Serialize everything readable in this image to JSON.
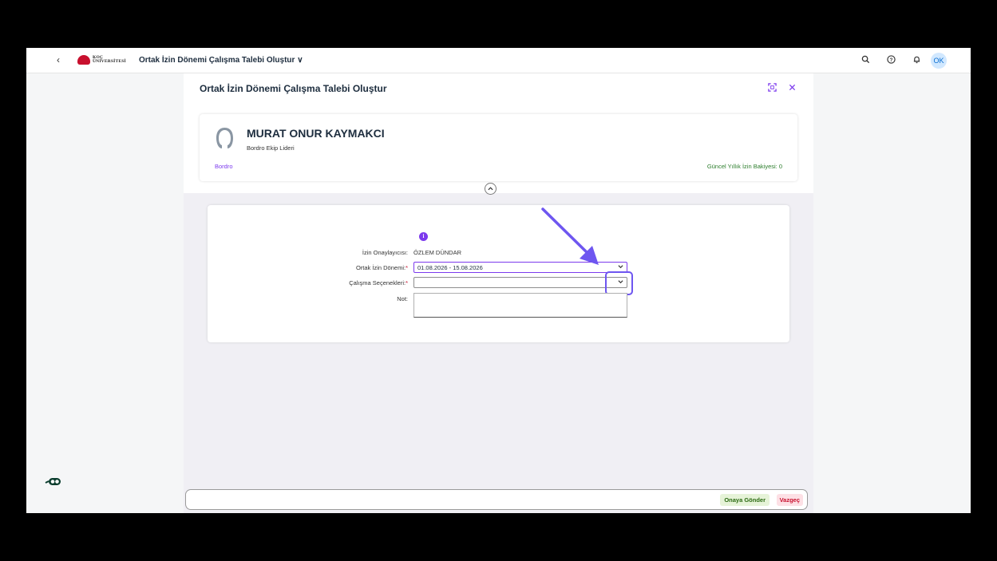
{
  "shell": {
    "back_icon": "‹",
    "logo_line1": "KOÇ",
    "logo_line2": "ÜNİVERSİTESİ",
    "app_title": "Ortak İzin Dönemi Çalışma Talebi Oluştur ∨",
    "avatar_initials": "OK",
    "icons": [
      "search-icon",
      "help-icon",
      "bell-icon"
    ]
  },
  "page": {
    "title": "Ortak İzin Dönemi Çalışma Talebi Oluştur"
  },
  "employee": {
    "name": "MURAT ONUR KAYMAKCI",
    "role": "Bordro Ekip Lideri",
    "department": "Bordro",
    "balance": "Güncel Yıllık İzin Bakiyesi: 0"
  },
  "form": {
    "approver_label": "İzin Onaylayıcısı:",
    "approver_value": "ÖZLEM DÜNDAR",
    "period_label": "Ortak İzin Dönemi:",
    "period_value": "01.08.2026 - 15.08.2026",
    "options_label": "Çalışma Seçenekleri:",
    "options_value": "",
    "note_label": "Not:",
    "required_mark": "*"
  },
  "footer": {
    "send_label": "Onaya Gönder",
    "cancel_label": "Vazgeç"
  },
  "colors": {
    "accent": "#7c3aed",
    "required": "#c8102e",
    "highlight": "#6e56f0"
  }
}
